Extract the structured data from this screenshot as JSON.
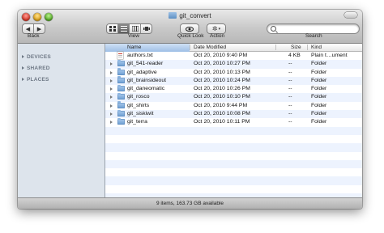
{
  "window": {
    "title": "git_convert"
  },
  "toolbar": {
    "back_label": "Back",
    "view_label": "View",
    "quicklook_label": "Quick Look",
    "action_label": "Action",
    "search_label": "Search",
    "search_placeholder": ""
  },
  "sidebar": {
    "sections": [
      "DEVICES",
      "SHARED",
      "PLACES"
    ]
  },
  "columns": {
    "name": "Name",
    "date": "Date Modified",
    "size": "Size",
    "kind": "Kind"
  },
  "files": [
    {
      "name": "authors.txt",
      "date": "Oct 20, 2010 9:40 PM",
      "size": "4 KB",
      "kind": "Plain t…ument",
      "type": "document"
    },
    {
      "name": "git_541-reader",
      "date": "Oct 20, 2010 10:27 PM",
      "size": "--",
      "kind": "Folder",
      "type": "folder"
    },
    {
      "name": "git_adaptive",
      "date": "Oct 20, 2010 10:13 PM",
      "size": "--",
      "kind": "Folder",
      "type": "folder"
    },
    {
      "name": "git_brainsideout",
      "date": "Oct 20, 2010 10:24 PM",
      "size": "--",
      "kind": "Folder",
      "type": "folder"
    },
    {
      "name": "git_daneomatic",
      "date": "Oct 20, 2010 10:26 PM",
      "size": "--",
      "kind": "Folder",
      "type": "folder"
    },
    {
      "name": "git_rosco",
      "date": "Oct 20, 2010 10:10 PM",
      "size": "--",
      "kind": "Folder",
      "type": "folder"
    },
    {
      "name": "git_shirts",
      "date": "Oct 20, 2010 9:44 PM",
      "size": "--",
      "kind": "Folder",
      "type": "folder"
    },
    {
      "name": "git_siskiwit",
      "date": "Oct 20, 2010 10:08 PM",
      "size": "--",
      "kind": "Folder",
      "type": "folder"
    },
    {
      "name": "git_terra",
      "date": "Oct 20, 2010 10:11 PM",
      "size": "--",
      "kind": "Folder",
      "type": "folder"
    }
  ],
  "status_bar": {
    "text": "9 items, 163.73 GB available"
  },
  "colors": {
    "sidebar_bg": "#dde4ec",
    "row_alt": "#edf3fe",
    "header_selected": "#9fbfe6"
  }
}
